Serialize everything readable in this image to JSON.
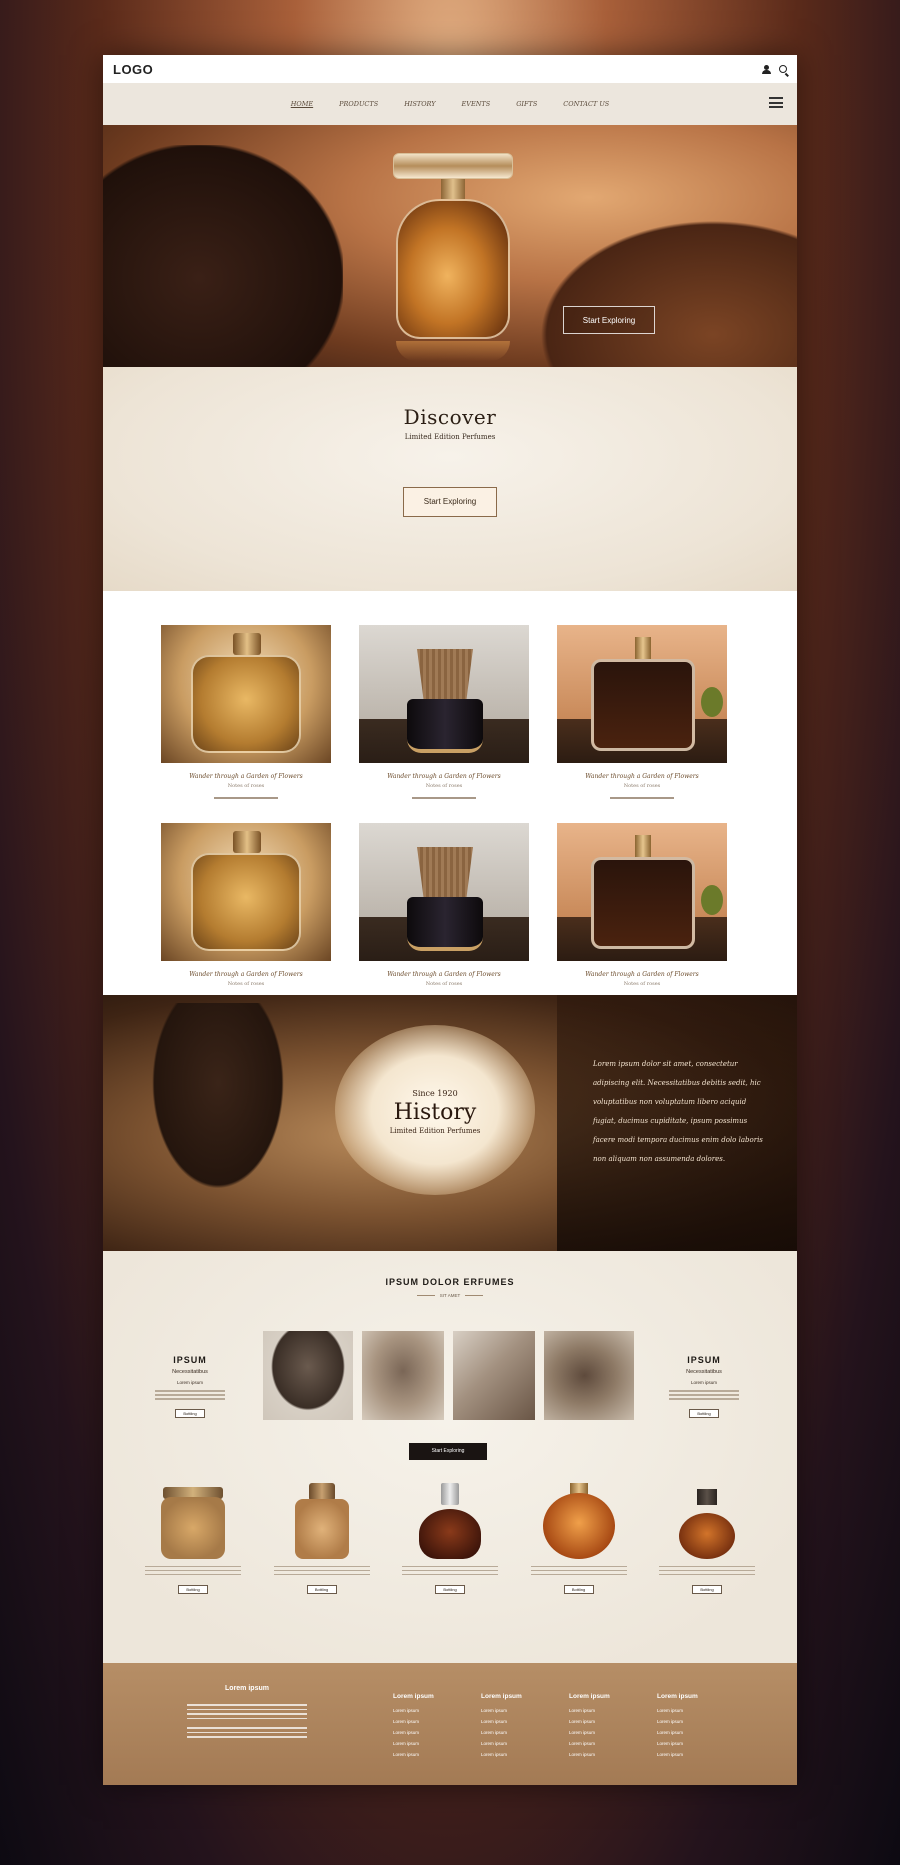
{
  "header": {
    "logo": "LOGO",
    "user_icon": "user-icon",
    "search_icon": "search-icon"
  },
  "nav": {
    "items": [
      "HOME",
      "PRODUCTS",
      "HISTORY",
      "EVENTS",
      "GIFTS",
      "CONTACT US"
    ],
    "active": "HOME",
    "menu_icon": "hamburger-menu-icon"
  },
  "hero": {
    "cta_label": "Start Exploring"
  },
  "discover": {
    "title": "Discover",
    "subtitle": "Limited Edition Perfumes",
    "cta_label": "Start Exploring"
  },
  "products": {
    "items": [
      {
        "name": "Wander through a Garden of Flowers",
        "sub": "Notes of roses"
      },
      {
        "name": "Wander through a Garden of Flowers",
        "sub": "Notes of roses"
      },
      {
        "name": "Wander through a Garden of Flowers",
        "sub": "Notes of roses"
      },
      {
        "name": "Wander through a Garden of Flowers",
        "sub": "Notes of roses"
      },
      {
        "name": "Wander through a Garden of Flowers",
        "sub": "Notes of roses"
      },
      {
        "name": "Wander through a Garden of Flowers",
        "sub": "Notes of roses"
      }
    ]
  },
  "history": {
    "since": "Since 1920",
    "title": "History",
    "subtitle": "Limited Edition Perfumes",
    "paragraph": "Lorem ipsum dolor sit amet, consectetur adipiscing elit. Necessitatibus debitis sedit, hic voluptatibus non voluptatum libero aciquid fugiat, ducimus cupiditate, ipsum possimus facere modi tempora ducimus enim dolo laboris non aliquam non assumenda dolores."
  },
  "gallery": {
    "title": "IPSUM DOLOR ERFUMES",
    "subtitle": "SIT AMET",
    "left": {
      "title": "IPSUM",
      "subtitle": "Necessitatibus",
      "caption": "Lorem ipsum",
      "button": "Bottling"
    },
    "right": {
      "title": "IPSUM",
      "subtitle": "Necessitatibus",
      "caption": "Lorem ipsum",
      "button": "Bottling"
    },
    "cta_label": "Start Exploring",
    "jar_button": "Bottling"
  },
  "footer": {
    "about_title": "Lorem ipsum",
    "columns": [
      {
        "title": "Lorem ipsum",
        "links": [
          "Lorem ipsum",
          "Lorem ipsum",
          "Lorem ipsum",
          "Lorem ipsum",
          "Lorem ipsum"
        ]
      },
      {
        "title": "Lorem ipsum",
        "links": [
          "Lorem ipsum",
          "Lorem ipsum",
          "Lorem ipsum",
          "Lorem ipsum",
          "Lorem ipsum"
        ]
      },
      {
        "title": "Lorem ipsum",
        "links": [
          "Lorem ipsum",
          "Lorem ipsum",
          "Lorem ipsum",
          "Lorem ipsum",
          "Lorem ipsum"
        ]
      },
      {
        "title": "Lorem ipsum",
        "links": [
          "Lorem ipsum",
          "Lorem ipsum",
          "Lorem ipsum",
          "Lorem ipsum",
          "Lorem ipsum"
        ]
      }
    ]
  },
  "colors": {
    "accent": "#a37a54",
    "dark": "#1a1412",
    "cream": "#ede6da"
  }
}
